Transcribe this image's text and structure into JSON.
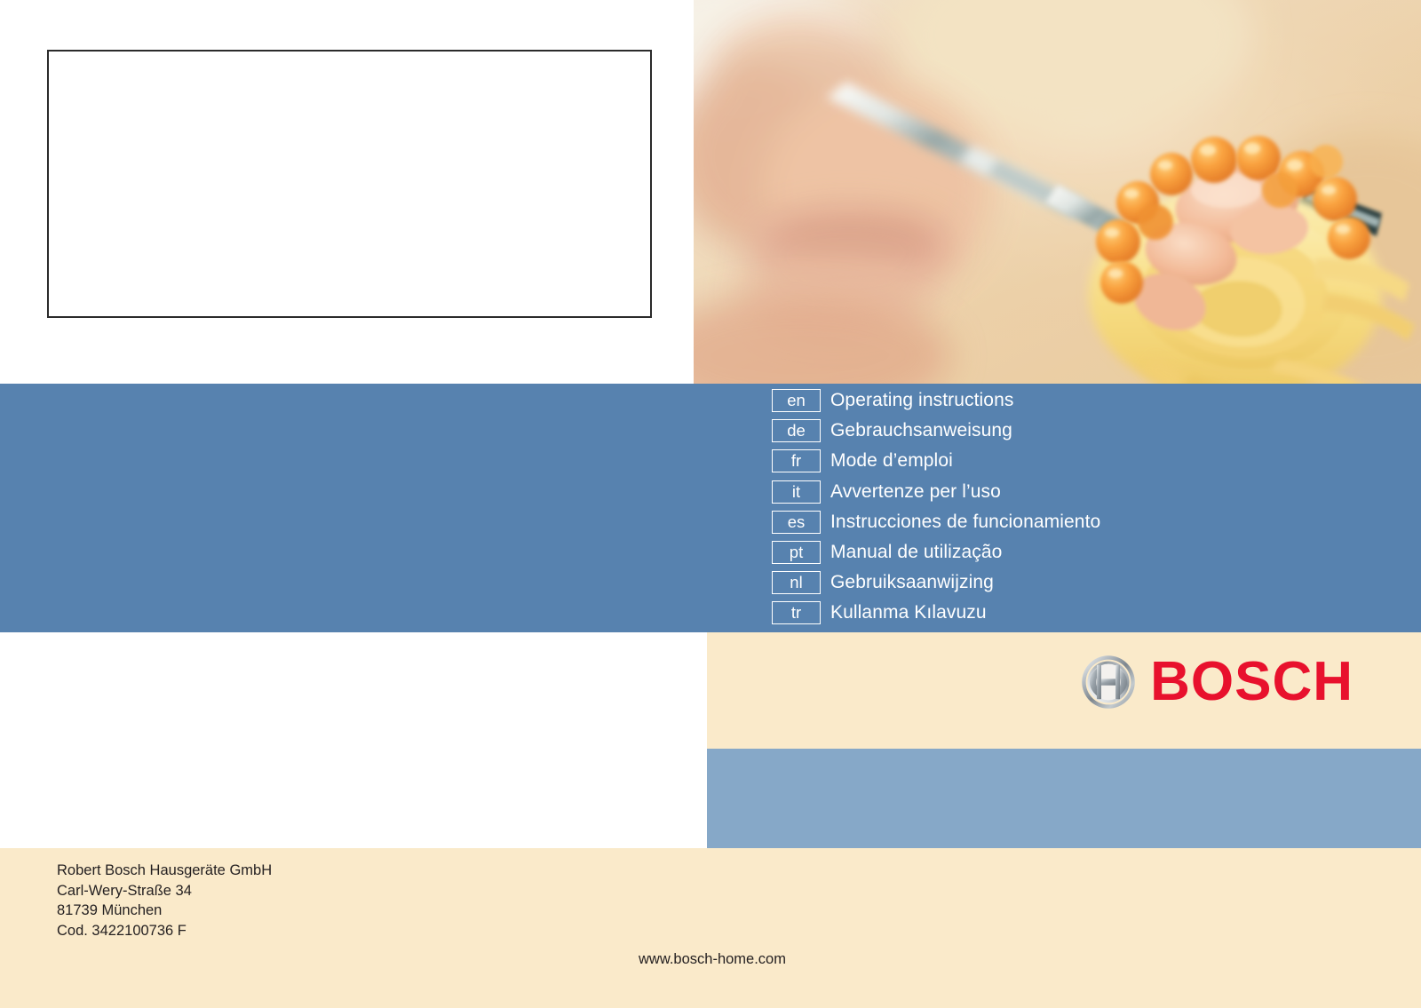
{
  "document": {
    "type": "appliance-manual-cover",
    "brand": "BOSCH"
  },
  "title_box": {
    "content": ""
  },
  "hero": {
    "alt": "spaghetti-with-salmon-roe-on-fork-photo"
  },
  "languages": [
    {
      "code": "en",
      "label": "Operating  instructions"
    },
    {
      "code": "de",
      "label": "Gebrauchsanweisung"
    },
    {
      "code": "fr",
      "label": "Mode d’emploi"
    },
    {
      "code": "it",
      "label": "Avvertenze per l’uso"
    },
    {
      "code": "es",
      "label": "Instrucciones de funcionamiento"
    },
    {
      "code": "pt",
      "label": "Manual de utilização"
    },
    {
      "code": "nl",
      "label": "Gebruiksaanwijzing"
    },
    {
      "code": "tr",
      "label": "Kullanma Kılavuzu"
    }
  ],
  "logo": {
    "wordmark": "BOSCH",
    "mark_name": "bosch-armature-symbol"
  },
  "footer": {
    "address": [
      "Robert Bosch Hausgeräte GmbH",
      "Carl-Wery-Straße 34",
      "81739 München",
      "Cod. 3422100736 F"
    ],
    "website": "www.bosch-home.com"
  },
  "colors": {
    "blue_main": "#5782AF",
    "blue_light": "#86A8C8",
    "cream": "#FAEACA",
    "bosch_red": "#E8112D",
    "white": "#FFFFFF",
    "text_dark": "#231F20"
  }
}
